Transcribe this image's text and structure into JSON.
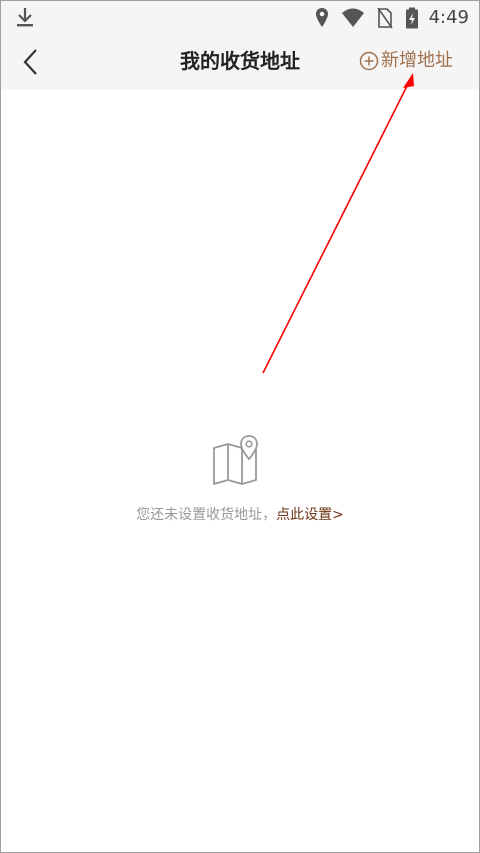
{
  "status_bar": {
    "time": "4:49",
    "icons": [
      "download-icon",
      "location-icon",
      "wifi-icon",
      "no-sim-icon",
      "battery-charging-icon"
    ]
  },
  "header": {
    "title": "我的收货地址",
    "add_button_label": "新增地址",
    "back_icon": "chevron-left-icon",
    "add_icon": "plus-circle-icon"
  },
  "empty_state": {
    "icon": "map-pin-icon",
    "message": "您还未设置收货地址，",
    "action_label": "点此设置>"
  },
  "colors": {
    "accent": "#a0714f",
    "link": "#6b3312",
    "muted_text": "#999999",
    "annotation": "#ff0000",
    "header_bg": "#f5f5f5"
  }
}
